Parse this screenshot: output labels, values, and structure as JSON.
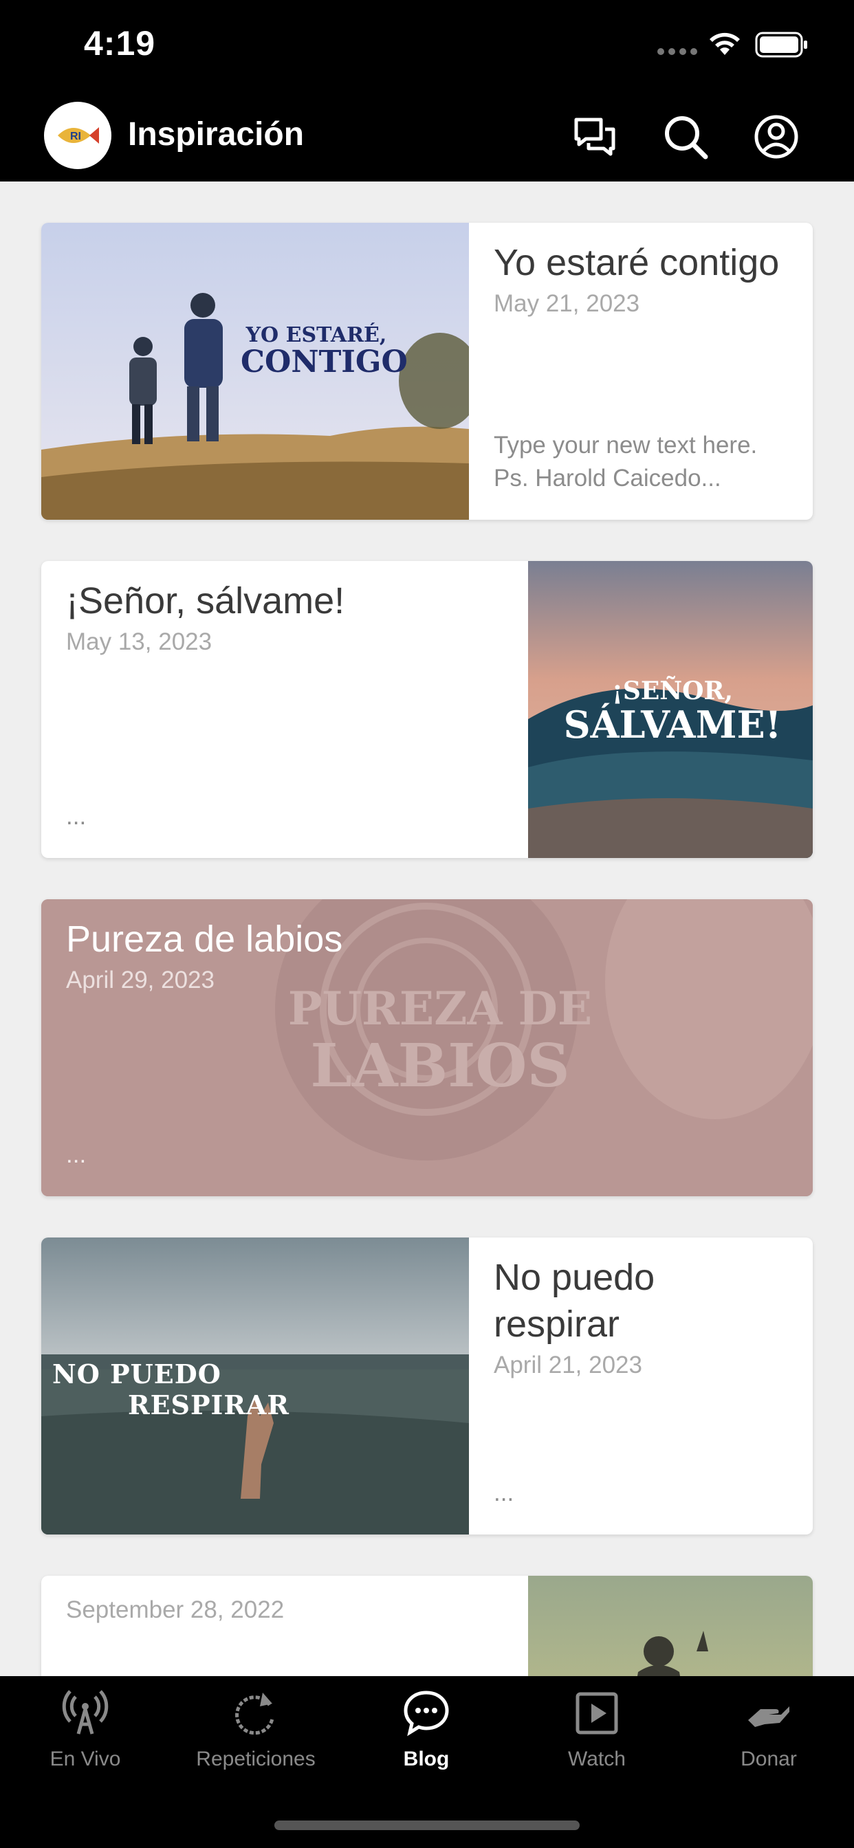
{
  "status_bar": {
    "time": "4:19"
  },
  "header": {
    "title": "Inspiración",
    "logo_text": "RI"
  },
  "posts": [
    {
      "title": "Yo estaré contigo",
      "date": "May 21, 2023",
      "excerpt": "Type your new text here. Ps. Harold Caicedo...",
      "image_text_line1": "YO ESTARÉ,",
      "image_text_line2": "CONTIGO"
    },
    {
      "title": "¡Señor, sálvame!",
      "date": "May 13, 2023",
      "excerpt": "...",
      "image_text_line1": "¡SEÑOR,",
      "image_text_line2": "SÁLVAME!"
    },
    {
      "title": "Pureza de labios",
      "date": "April 29, 2023",
      "excerpt": "...",
      "image_text_line1": "PUREZA DE",
      "image_text_line2": "LABIOS"
    },
    {
      "title": "No puedo respirar",
      "date": "April 21, 2023",
      "excerpt": "...",
      "image_text_line1": "NO PUEDO",
      "image_text_line2": "RESPIRAR"
    },
    {
      "title": "",
      "date": "September 28, 2022",
      "excerpt": ""
    }
  ],
  "tabs": [
    {
      "label": "En Vivo",
      "icon": "antenna-icon"
    },
    {
      "label": "Repeticiones",
      "icon": "refresh-icon"
    },
    {
      "label": "Blog",
      "icon": "chat-bubble-icon",
      "active": true
    },
    {
      "label": "Watch",
      "icon": "play-square-icon"
    },
    {
      "label": "Donar",
      "icon": "hand-give-icon"
    }
  ]
}
